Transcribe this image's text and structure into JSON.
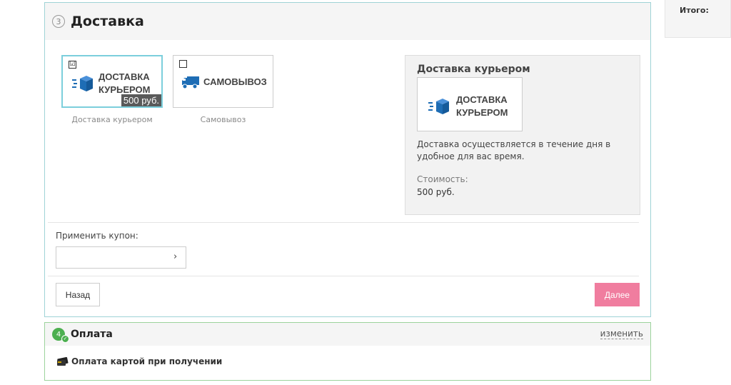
{
  "delivery": {
    "step_number": "3",
    "title": "Доставка",
    "options": [
      {
        "logo_line1": "ДОСТАВКА",
        "logo_line2": "КУРЬЕРОМ",
        "price": "500 руб.",
        "caption": "Доставка курьером",
        "checked": "☑"
      },
      {
        "logo_line1": "САМОВЫВОЗ",
        "caption": "Самовывоз"
      }
    ],
    "info": {
      "title": "Доставка курьером",
      "logo_line1": "ДОСТАВКА",
      "logo_line2": "КУРЬЕРОМ",
      "description": "Доставка осуществляется в течение дня в удобное для вас время.",
      "cost_label": "Стоимость:",
      "cost_value": "500 руб."
    },
    "coupon": {
      "label": "Применить купон:",
      "placeholder": "",
      "arrow": "›"
    },
    "back_label": "Назад",
    "next_label": "Далее"
  },
  "payment": {
    "step_number": "4",
    "tick": "✓",
    "title": "Оплата",
    "change_label": "изменить",
    "method": "Оплата картой при получении"
  },
  "summary": {
    "total_label": "Итого:"
  },
  "colors": {
    "accent_border": "#9fd3d6",
    "selected_border": "#7ccfdc",
    "next_button": "#f07d9f",
    "done_green": "#4caf50",
    "icon_blue": "#1e6db5"
  },
  "icons": [
    "box-icon",
    "truck-icon",
    "card-icon",
    "check-icon",
    "chevron-right-icon"
  ]
}
